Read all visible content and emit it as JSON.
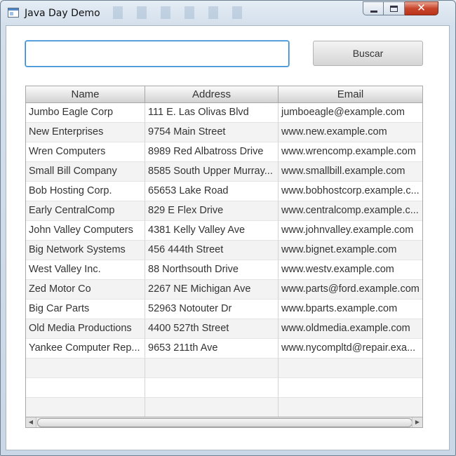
{
  "window": {
    "title": "Java Day Demo",
    "controls": {
      "minimize": "",
      "maximize": "",
      "close": "✕"
    }
  },
  "search": {
    "value": "",
    "placeholder": ""
  },
  "buttons": {
    "search_label": "Buscar"
  },
  "table": {
    "columns": [
      "Name",
      "Address",
      "Email"
    ],
    "rows": [
      [
        "Jumbo Eagle Corp",
        "111 E. Las Olivas Blvd",
        "jumboeagle@example.com"
      ],
      [
        "New Enterprises",
        "9754 Main Street",
        "www.new.example.com"
      ],
      [
        "Wren Computers",
        "8989 Red Albatross Drive",
        "www.wrencomp.example.com"
      ],
      [
        "Small Bill Company",
        "8585 South Upper Murray...",
        "www.smallbill.example.com"
      ],
      [
        "Bob Hosting Corp.",
        "65653 Lake Road",
        "www.bobhostcorp.example.c..."
      ],
      [
        "Early CentralComp",
        "829 E Flex Drive",
        "www.centralcomp.example.c..."
      ],
      [
        "John Valley Computers",
        "4381 Kelly Valley Ave",
        "www.johnvalley.example.com"
      ],
      [
        "Big Network Systems",
        "456 444th Street",
        "www.bignet.example.com"
      ],
      [
        "West Valley Inc.",
        "88 Northsouth Drive",
        "www.westv.example.com"
      ],
      [
        "Zed Motor Co",
        "2267 NE Michigan Ave",
        "www.parts@ford.example.com"
      ],
      [
        "Big Car Parts",
        "52963 Notouter Dr",
        "www.bparts.example.com"
      ],
      [
        "Old Media Productions",
        "4400 527th Street",
        "www.oldmedia.example.com"
      ],
      [
        "Yankee Computer Rep...",
        "9653 211th Ave",
        "www.nycompltd@repair.exa..."
      ],
      [
        "",
        "",
        ""
      ],
      [
        "",
        "",
        ""
      ],
      [
        "",
        "",
        ""
      ]
    ]
  },
  "scrollbar": {
    "left_arrow": "◀",
    "right_arrow": "▶"
  }
}
